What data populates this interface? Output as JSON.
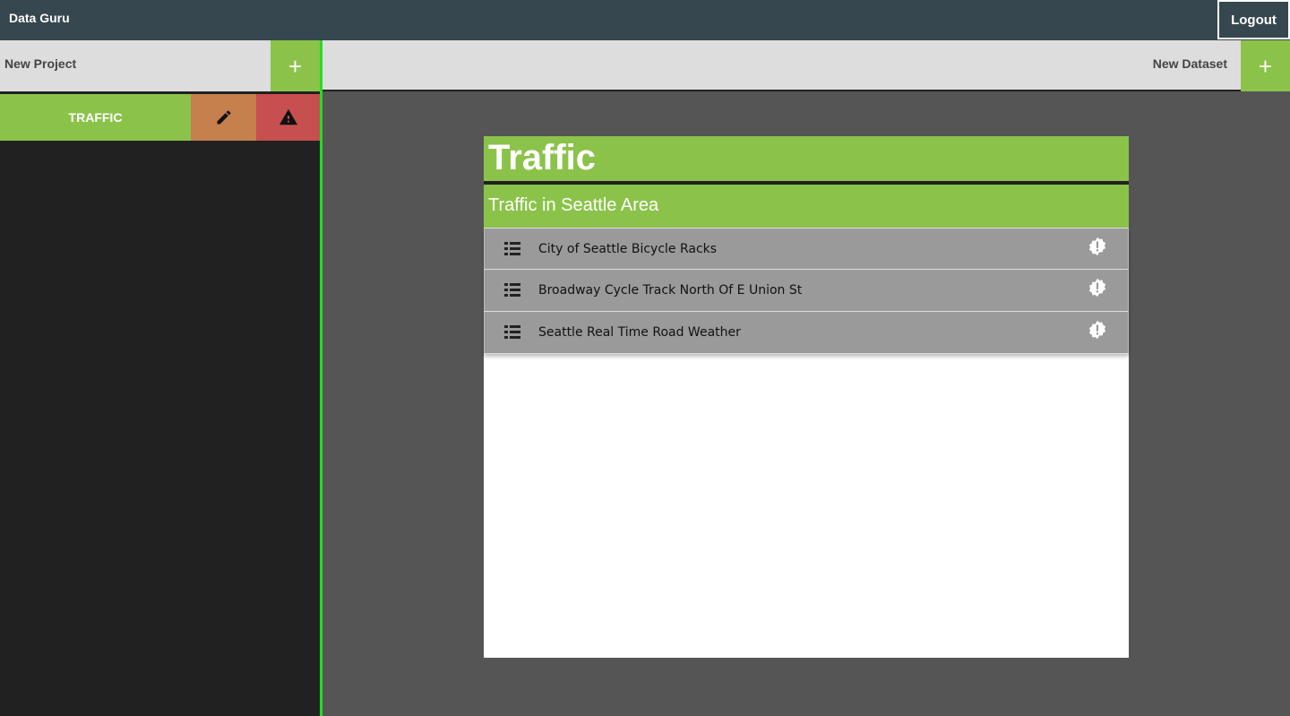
{
  "app": {
    "title": "Data Guru",
    "logout_label": "Logout"
  },
  "sidebar": {
    "new_project_label": "New Project",
    "add_icon": "plus-icon",
    "projects": [
      {
        "name": "TRAFFIC",
        "edit_icon": "pencil-icon",
        "delete_icon": "warning-icon"
      }
    ]
  },
  "datasets_bar": {
    "new_dataset_label": "New Dataset",
    "add_icon": "plus-icon"
  },
  "project_card": {
    "title": "Traffic",
    "description": "Traffic in Seattle Area",
    "datasets": [
      {
        "name": "City of Seattle Bicycle Racks",
        "icon": "list-icon",
        "status_icon": "alert-badge-icon"
      },
      {
        "name": "Broadway Cycle Track North Of E Union St",
        "icon": "list-icon",
        "status_icon": "alert-badge-icon"
      },
      {
        "name": "Seattle Real Time Road Weather",
        "icon": "list-icon",
        "status_icon": "alert-badge-icon"
      }
    ]
  },
  "colors": {
    "topbar": "#37474f",
    "accent_green": "#8bc34a",
    "edit_orange": "#c6804d",
    "delete_red": "#c84f4f",
    "sidebar_bg": "#212121",
    "divider_green": "#22dd22",
    "main_bg": "#555555"
  }
}
